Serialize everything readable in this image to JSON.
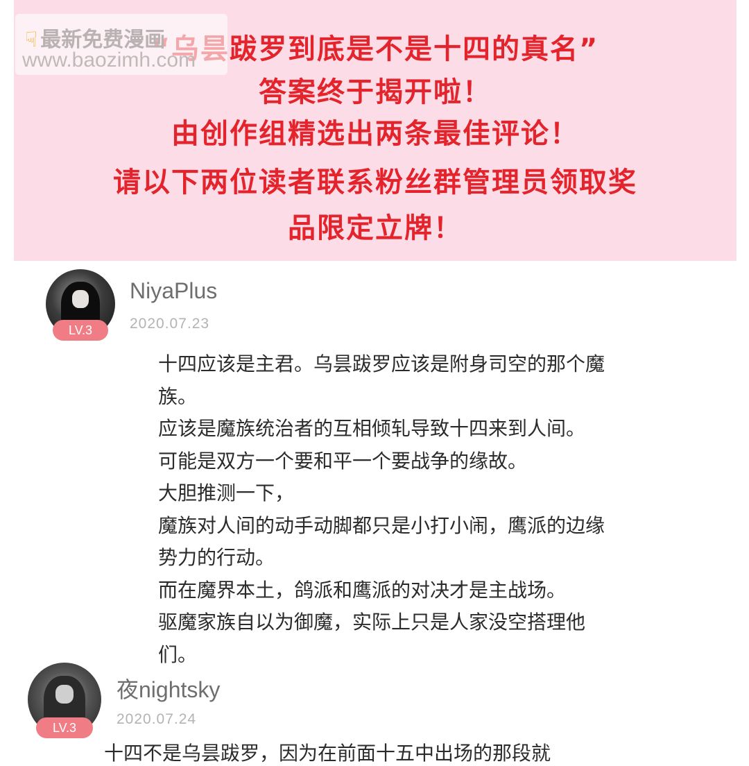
{
  "banner": {
    "lines": [
      "“乌昙跋罗到底是不是十四的真名”",
      "答案终于揭开啦！",
      "由创作组精选出两条最佳评论！",
      "请以下两位读者联系粉丝群管理员领取奖",
      "品限定立牌！"
    ]
  },
  "watermark": {
    "line1": "最新免费漫画",
    "line2": "www.baozimh.com"
  },
  "comments": [
    {
      "username": "NiyaPlus",
      "date": "2020.07.23",
      "level": "LV.3",
      "lines": [
        "十四应该是主君。乌昙跋罗应该是附身司空的那个魔",
        "族。",
        "应该是魔族统治者的互相倾轧导致十四来到人间。",
        "可能是双方一个要和平一个要战争的缘故。",
        "大胆推测一下，",
        "魔族对人间的动手动脚都只是小打小闹，鹰派的边缘",
        "势力的行动。",
        "而在魔界本土，鸽派和鹰派的对决才是主战场。",
        "驱魔家族自以为御魔，实际上只是人家没空搭理他",
        "们。"
      ]
    },
    {
      "username": "夜nightsky",
      "date": "2020.07.24",
      "level": "LV.3",
      "partial_line": "十四不是乌昙跋罗，因为在前面十五中出场的那段就"
    }
  ],
  "colors": {
    "banner_bg": "#fcdde7",
    "banner_text": "#e4242c",
    "badge": "#f07d86"
  }
}
